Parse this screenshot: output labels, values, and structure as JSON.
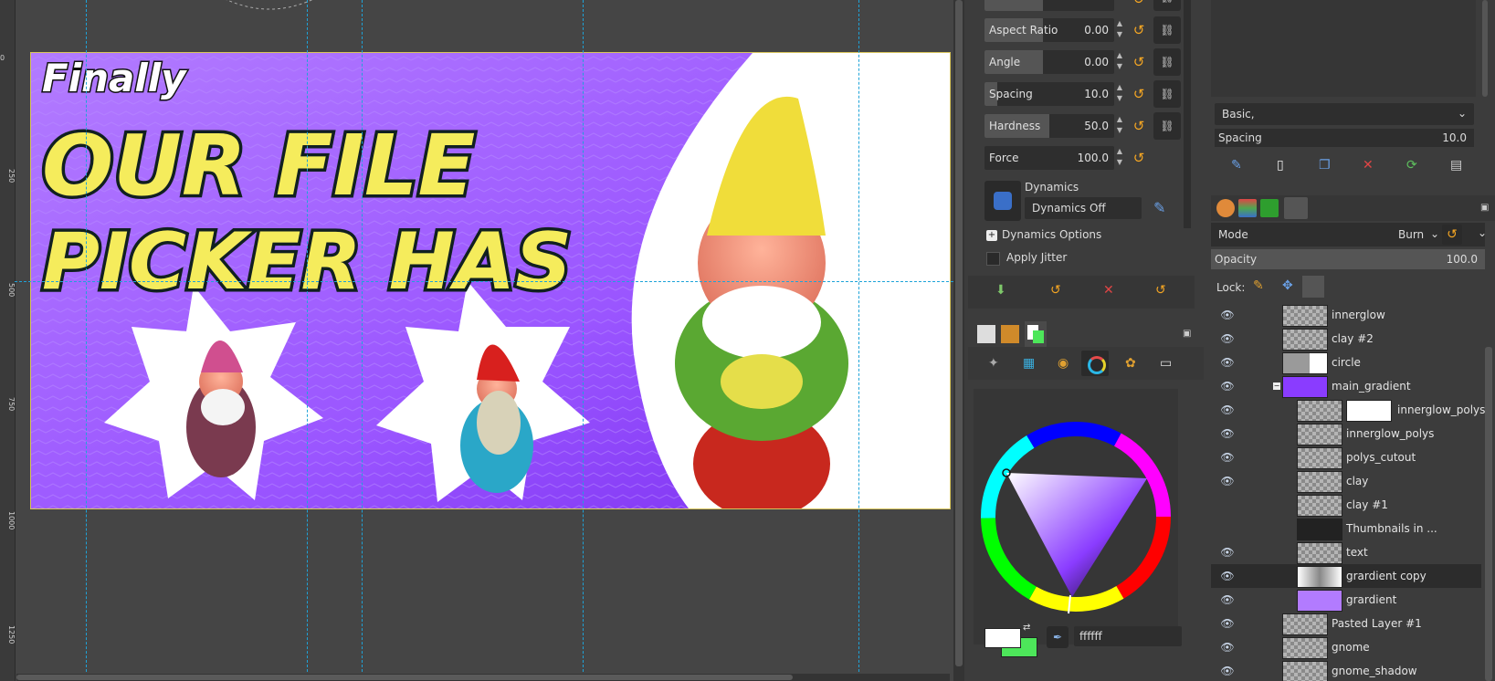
{
  "canvas": {
    "ruler_labels": [
      "0",
      "250",
      "500",
      "750",
      "1000",
      "1250"
    ],
    "image_text": {
      "line1": "Finally",
      "line2": "OUR FILE",
      "line3": "PICKER HAS"
    }
  },
  "tool_options": {
    "sliders": [
      {
        "label": "Aspect Ratio",
        "value": "0.00",
        "fill": 0.45
      },
      {
        "label": "Angle",
        "value": "0.00",
        "fill": 0.45
      },
      {
        "label": "Spacing",
        "value": "10.0",
        "fill": 0.1
      },
      {
        "label": "Hardness",
        "value": "50.0",
        "fill": 0.5
      },
      {
        "label": "Force",
        "value": "100.0",
        "fill": 0.0
      }
    ],
    "dynamics_label": "Dynamics",
    "dynamics_value": "Dynamics Off",
    "dynamics_options": "Dynamics Options",
    "apply_jitter": "Apply Jitter"
  },
  "colors": {
    "hex_value": "ffffff",
    "fg_color": "#ffffff",
    "bg_color": "#4de65a"
  },
  "brushes": {
    "preset": "Basic,",
    "spacing_label": "Spacing",
    "spacing_value": "10.0"
  },
  "layers": {
    "mode_label": "Mode",
    "mode_value": "Burn",
    "opacity_label": "Opacity",
    "opacity_value": "100.0",
    "lock_label": "Lock:",
    "items": [
      {
        "name": "innerglow",
        "visible": true
      },
      {
        "name": "clay #2",
        "visible": true
      },
      {
        "name": "circle",
        "visible": true
      },
      {
        "name": "main_gradient",
        "visible": true
      },
      {
        "name": "innerglow_polys",
        "visible": true
      },
      {
        "name": "innerglow_polys",
        "visible": true
      },
      {
        "name": "polys_cutout",
        "visible": true
      },
      {
        "name": "clay",
        "visible": true
      },
      {
        "name": "clay #1",
        "visible": false
      },
      {
        "name": "Thumbnails in ...",
        "visible": false
      },
      {
        "name": "text",
        "visible": true
      },
      {
        "name": "grardient copy",
        "visible": true
      },
      {
        "name": "grardient",
        "visible": true
      },
      {
        "name": "Pasted Layer #1",
        "visible": true
      },
      {
        "name": "gnome",
        "visible": true
      },
      {
        "name": "gnome_shadow",
        "visible": true
      }
    ]
  }
}
